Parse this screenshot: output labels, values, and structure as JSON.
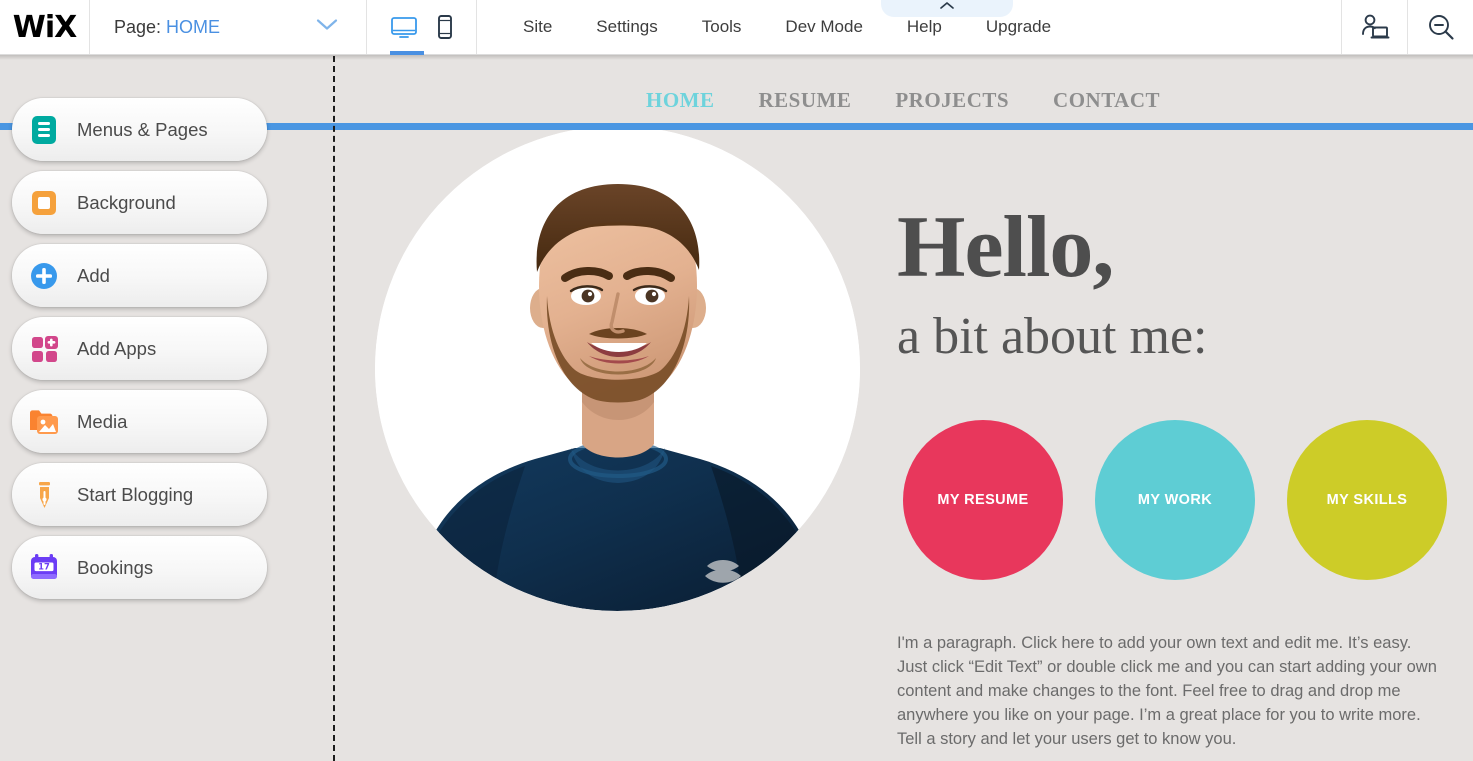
{
  "topbar": {
    "logo": "WiX",
    "page_prefix": "Page:",
    "page_name": "HOME",
    "page_chevron_icon": "chevron-down-icon",
    "desktop_icon": "desktop-monitor-icon",
    "mobile_icon": "mobile-phone-icon",
    "collapse_icon": "chevron-up-icon",
    "menu": [
      {
        "label": "Site"
      },
      {
        "label": "Settings"
      },
      {
        "label": "Tools"
      },
      {
        "label": "Dev Mode"
      },
      {
        "label": "Help"
      },
      {
        "label": "Upgrade"
      }
    ],
    "right_icons": [
      {
        "name": "user-computer-icon"
      },
      {
        "name": "zoom-out-icon"
      }
    ]
  },
  "sidebar": {
    "items": [
      {
        "label": "Menus & Pages",
        "icon": "menus-pages-icon",
        "color": "#00aaa0"
      },
      {
        "label": "Background",
        "icon": "background-icon",
        "color": "#f5a13c"
      },
      {
        "label": "Add",
        "icon": "add-plus-icon",
        "color": "#3899ec"
      },
      {
        "label": "Add Apps",
        "icon": "add-apps-icon",
        "color": "#d2478b"
      },
      {
        "label": "Media",
        "icon": "media-image-icon",
        "color": "#fa8330"
      },
      {
        "label": "Start Blogging",
        "icon": "blog-pen-icon",
        "color": "#f7a64a"
      },
      {
        "label": "Bookings",
        "icon": "bookings-calendar-icon",
        "color": "#6b3df5"
      }
    ]
  },
  "canvas": {
    "background_color": "#e6e3e1",
    "guide_line_color": "#4a96e2",
    "site_nav": [
      {
        "label": "HOME",
        "active": true
      },
      {
        "label": "RESUME",
        "active": false
      },
      {
        "label": "PROJECTS",
        "active": false
      },
      {
        "label": "CONTACT",
        "active": false
      }
    ],
    "portrait_alt": "portrait of smiling bearded man in navy athletic shirt",
    "hero": {
      "heading": "Hello,",
      "subheading": "a bit about me:",
      "paragraph": "I'm a paragraph. Click here to add your own text and edit me. It’s easy. Just click “Edit Text” or double click me and you can start adding your own content and make changes to the font. Feel free to drag and drop me anywhere you like on your page. I’m a great place for you to write more. Tell a story and let your users get to know you."
    },
    "circles": [
      {
        "label": "MY RESUME",
        "color": "#e8375c"
      },
      {
        "label": "MY WORK",
        "color": "#5ecdd4"
      },
      {
        "label": "MY SKILLS",
        "color": "#cdcc28"
      }
    ]
  }
}
